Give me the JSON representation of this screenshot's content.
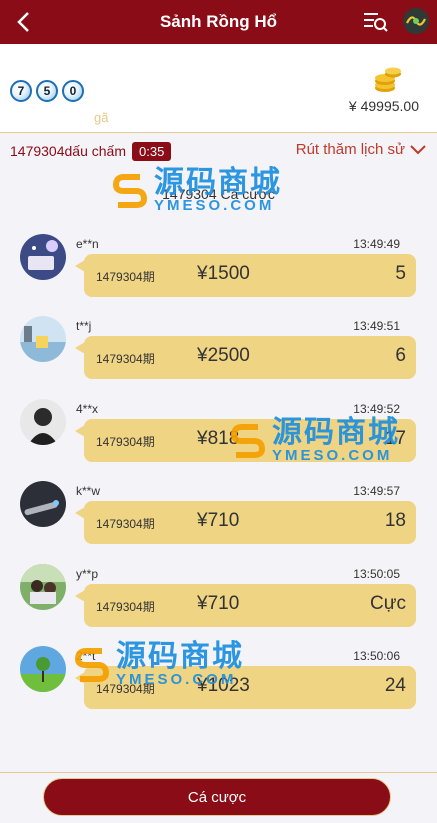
{
  "header": {
    "title": "Sảnh Rồng Hổ"
  },
  "info": {
    "balls": [
      "7",
      "5",
      "0"
    ],
    "ball_note": "gã",
    "balance": "¥ 49995.00"
  },
  "period": {
    "label": "1479304dấu chấm",
    "timer": "0:35",
    "history_link": "Rút thăm lịch sử"
  },
  "sub_title": "1479304 Cá cược",
  "bets": [
    {
      "user": "e**n",
      "time": "13:49:49",
      "period": "1479304期",
      "amount": "¥1500",
      "choice": "5"
    },
    {
      "user": "t**j",
      "time": "13:49:51",
      "period": "1479304期",
      "amount": "¥2500",
      "choice": "6"
    },
    {
      "user": "4**x",
      "time": "13:49:52",
      "period": "1479304期",
      "amount": "¥818",
      "choice": "17"
    },
    {
      "user": "k**w",
      "time": "13:49:57",
      "period": "1479304期",
      "amount": "¥710",
      "choice": "18"
    },
    {
      "user": "y**p",
      "time": "13:50:05",
      "period": "1479304期",
      "amount": "¥710",
      "choice": "Cực"
    },
    {
      "user": "2**t",
      "time": "13:50:06",
      "period": "1479304期",
      "amount": "¥1023",
      "choice": "24"
    }
  ],
  "footer": {
    "bet_button": "Cá cược"
  },
  "watermark": {
    "cn": "源码商城",
    "en": "YMESO.COM"
  },
  "colors": {
    "brand": "#8a0c16",
    "bubble": "#efd484",
    "accent_border": "#e6c98c"
  }
}
